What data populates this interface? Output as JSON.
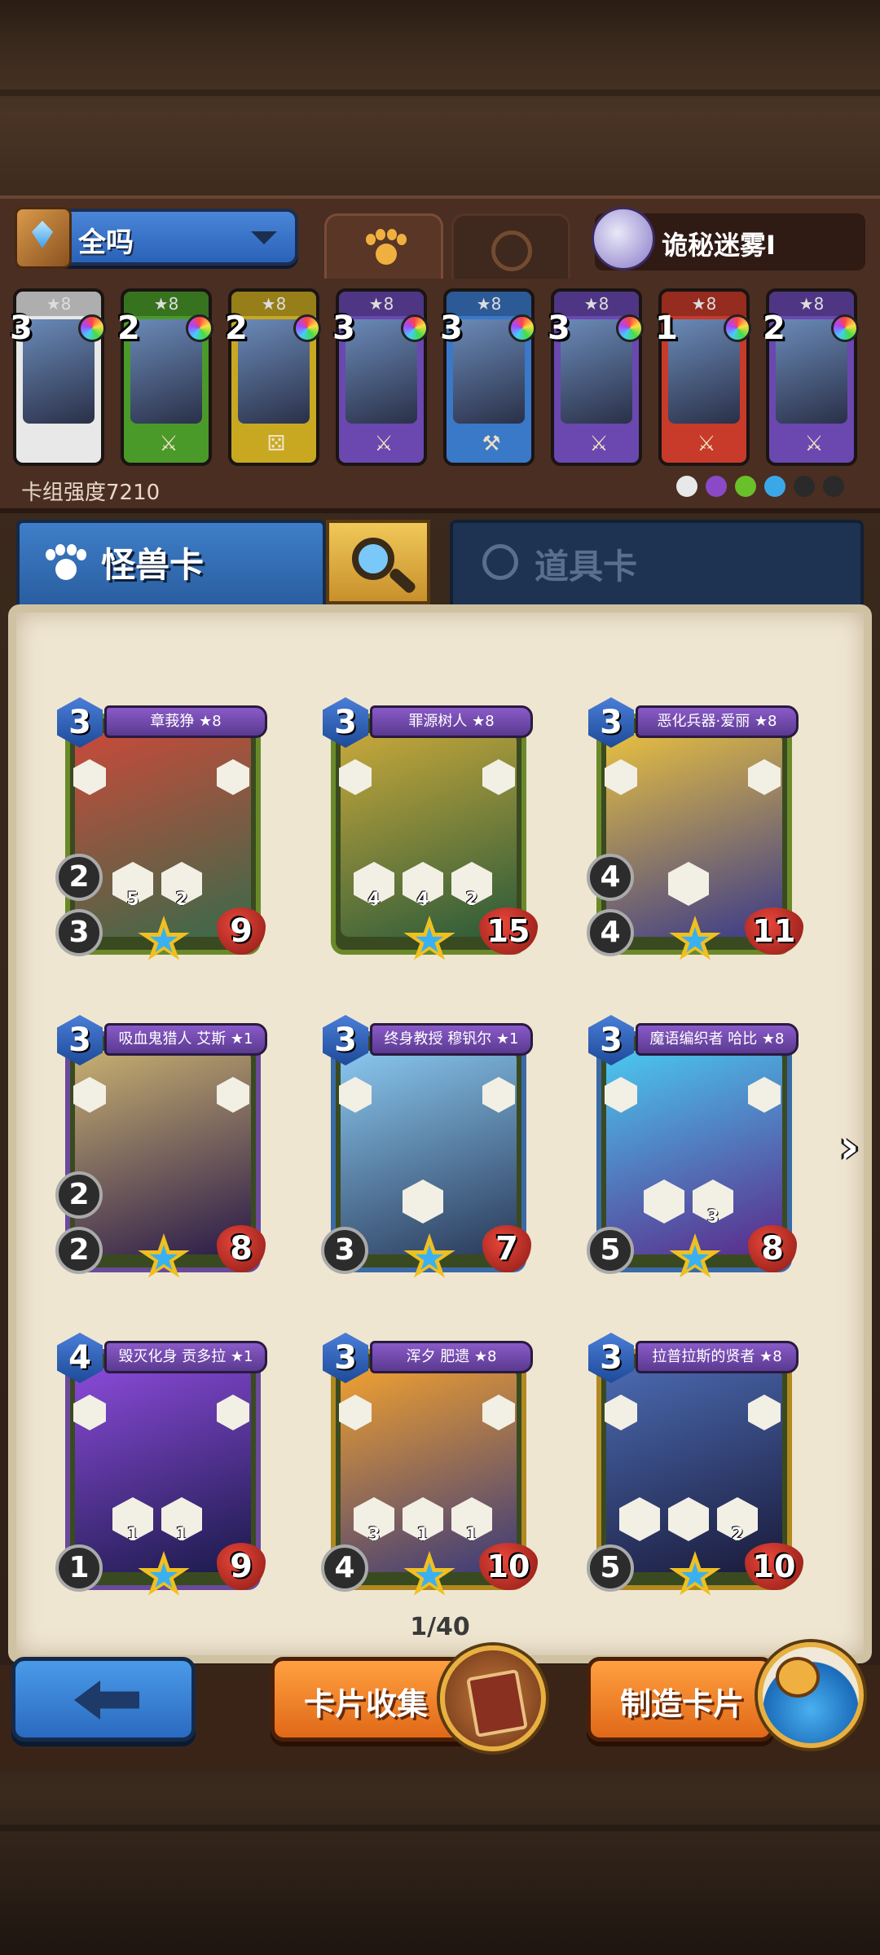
{
  "header": {
    "deck_name": "全吗",
    "opponent_name": "诡秘迷雾Ⅰ",
    "deck_strength": "卡组强度7210"
  },
  "top_tabs": [
    {
      "name": "monster",
      "icon": "paw-icon",
      "active": true
    },
    {
      "name": "item",
      "icon": "potion-icon",
      "active": false
    }
  ],
  "deck_cards": [
    {
      "cost": "3",
      "stars": "★8",
      "color": "#e8e8e8",
      "weapon": ""
    },
    {
      "cost": "2",
      "stars": "★8",
      "color": "#4a9a2a",
      "weapon": "⚔"
    },
    {
      "cost": "2",
      "stars": "★8",
      "color": "#c8a820",
      "weapon": "⚄"
    },
    {
      "cost": "3",
      "stars": "★8",
      "color": "#6a48b0",
      "weapon": "⚔"
    },
    {
      "cost": "3",
      "stars": "★8",
      "color": "#3a78c8",
      "weapon": "⚒"
    },
    {
      "cost": "3",
      "stars": "★8",
      "color": "#6a48b0",
      "weapon": "⚔"
    },
    {
      "cost": "1",
      "stars": "★8",
      "color": "#c83a2a",
      "weapon": "⚔"
    },
    {
      "cost": "2",
      "stars": "★8",
      "color": "#6a48b0",
      "weapon": "⚔"
    }
  ],
  "faction_dots": [
    "#e8e8e8",
    "#8a4ac8",
    "#6ac02a",
    "#3aa8e8",
    "#2a2a2a",
    "#2a2a2a"
  ],
  "lower_tabs": {
    "monster_label": "怪兽卡",
    "item_label": "道具卡"
  },
  "cards": [
    {
      "name": "章莪狰 ★8",
      "cost": "3",
      "hp": "9",
      "atk": "3",
      "dice": "2",
      "frame": "green",
      "art": [
        "#c84a3a",
        "#3a6a4a"
      ],
      "abilities": [
        "5",
        "2"
      ]
    },
    {
      "name": "罪源树人 ★8",
      "cost": "3",
      "hp": "15",
      "atk": "",
      "dice": "",
      "frame": "green",
      "art": [
        "#c8a83a",
        "#2a5a3a"
      ],
      "abilities": [
        "4",
        "4",
        "2"
      ]
    },
    {
      "name": "恶化兵器·爱丽 ★8",
      "cost": "3",
      "hp": "11",
      "atk": "4",
      "dice": "4",
      "frame": "green",
      "art": [
        "#e8c040",
        "#3a3a8a"
      ],
      "abilities": [
        ""
      ]
    },
    {
      "name": "吸血鬼猎人 艾斯 ★1",
      "cost": "3",
      "hp": "8",
      "atk": "2",
      "dice": "2",
      "frame": "purple",
      "art": [
        "#c8b070",
        "#2a1a4a"
      ],
      "abilities": []
    },
    {
      "name": "终身教授 穆钒尔 ★1",
      "cost": "3",
      "hp": "7",
      "atk": "3",
      "dice": "",
      "frame": "blue",
      "art": [
        "#8ac8f0",
        "#2a3a5a"
      ],
      "abilities": [
        ""
      ]
    },
    {
      "name": "魔语编织者 哈比 ★8",
      "cost": "3",
      "hp": "8",
      "atk": "5",
      "dice": "",
      "frame": "blue",
      "art": [
        "#4ac8f0",
        "#5a2a8a"
      ],
      "abilities": [
        "",
        "3"
      ]
    },
    {
      "name": "毁灭化身 贡多拉 ★1",
      "cost": "4",
      "hp": "9",
      "atk": "1",
      "dice": "",
      "frame": "purple",
      "art": [
        "#8a4ad8",
        "#1a1a4a"
      ],
      "abilities": [
        "1",
        "1"
      ]
    },
    {
      "name": "浑夕 肥遗 ★8",
      "cost": "3",
      "hp": "10",
      "atk": "4",
      "dice": "",
      "frame": "gold",
      "art": [
        "#f0a030",
        "#3a3a7a"
      ],
      "abilities": [
        "3",
        "1",
        "1"
      ]
    },
    {
      "name": "拉普拉斯的贤者 ★8",
      "cost": "3",
      "hp": "10",
      "atk": "5",
      "dice": "",
      "frame": "gold",
      "art": [
        "#4a6ab0",
        "#1a1a3a"
      ],
      "abilities": [
        "",
        "",
        "2"
      ]
    }
  ],
  "pagination": "1/40",
  "buttons": {
    "collect": "卡片收集",
    "craft": "制造卡片"
  }
}
